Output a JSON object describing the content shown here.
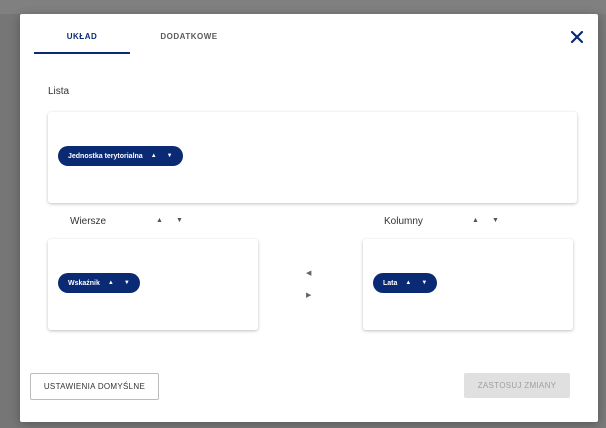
{
  "dialog": {
    "tabs": [
      {
        "label": "UKŁAD",
        "active": true
      },
      {
        "label": "DODATKOWE",
        "active": false
      }
    ],
    "close_icon": "close-icon"
  },
  "lista": {
    "label": "Lista",
    "chips": [
      {
        "label": "Jednostka terytorialna"
      }
    ]
  },
  "wiersze": {
    "label": "Wiersze",
    "chips": [
      {
        "label": "Wskaźnik"
      }
    ]
  },
  "kolumny": {
    "label": "Kolumny",
    "chips": [
      {
        "label": "Lata"
      }
    ]
  },
  "buttons": {
    "default": "USTAWIENIA DOMYŚLNE",
    "apply": "ZASTOSUJ ZMIANY"
  },
  "colors": {
    "accent": "#0b2a74",
    "apply_disabled_bg": "#e0e0e0"
  }
}
